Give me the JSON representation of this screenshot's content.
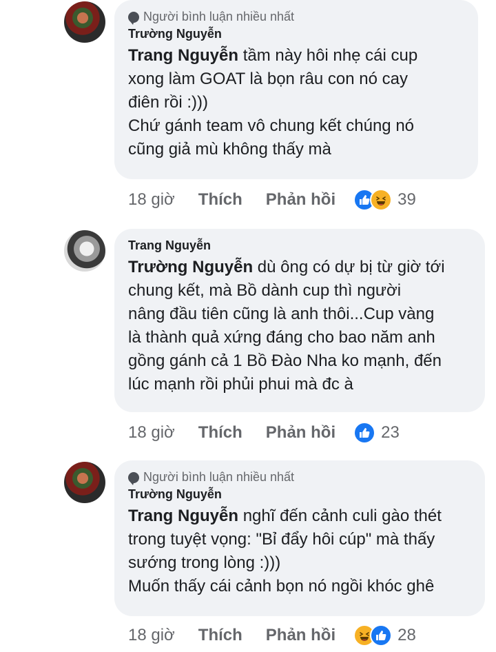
{
  "comments": [
    {
      "badge": "Người bình luận nhiều nhất",
      "author": "Trường Nguyễn",
      "mention": "Trang Nguyễn",
      "text": " tầm này hôi nhẹ cái cup\nxong làm GOAT là bọn râu con nó cay\nđiên rồi :)))\nChứ gánh team vô chung kết chúng nó\ncũng giả mù không thấy mà",
      "time": "18 giờ",
      "like_label": "Thích",
      "reply_label": "Phản hồi",
      "reactions": [
        "like",
        "haha"
      ],
      "reaction_count": "39"
    },
    {
      "author": "Trang Nguyễn",
      "mention": "Trường Nguyễn",
      "text": " dù ông có dự bị từ giờ tới\nchung kết, mà Bồ dành cup thì người\nnâng đầu tiên cũng là anh thôi...Cup vàng\nlà thành quả xứng đáng cho bao năm anh\ngồng gánh cả 1 Bồ Đào Nha ko mạnh, đến\nlúc mạnh rồi phủi phui mà đc à",
      "time": "18 giờ",
      "like_label": "Thích",
      "reply_label": "Phản hồi",
      "reactions": [
        "like"
      ],
      "reaction_count": "23"
    },
    {
      "badge": "Người bình luận nhiều nhất",
      "author": "Trường Nguyễn",
      "mention": "Trang Nguyễn",
      "text": " nghĩ đến cảnh culi gào thét\ntrong tuyệt vọng: \"Bỉ đẩy hôi cúp\" mà thấy\nsướng trong lòng :)))\nMuốn thấy cái cảnh bọn nó ngồi khóc ghê",
      "time": "18 giờ",
      "like_label": "Thích",
      "reply_label": "Phản hồi",
      "reactions": [
        "haha",
        "like"
      ],
      "reaction_count": "28"
    }
  ],
  "colors": {
    "bubble": "#f0f2f5",
    "like": "#1877f2",
    "haha": "#f7b125",
    "muted": "#65676b"
  }
}
